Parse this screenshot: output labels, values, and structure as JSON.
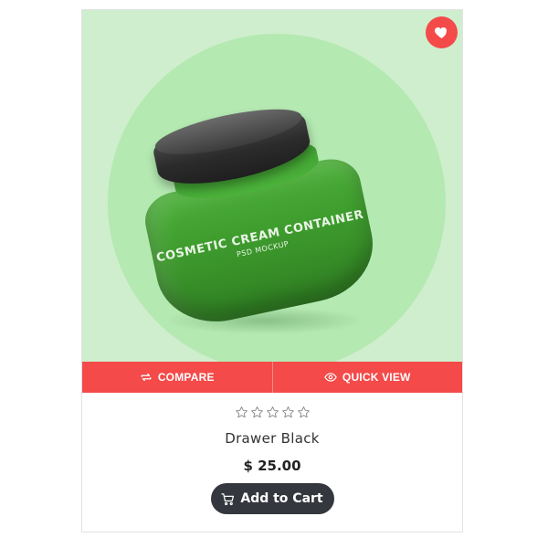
{
  "product": {
    "title": "Drawer Black",
    "price": "$ 25.00",
    "rating": 0,
    "rating_max": 5,
    "image_text": {
      "line1": "COSMETIC CREAM CONTAINER",
      "line2": "PSD MOCKUP"
    }
  },
  "actions": {
    "compare_label": "COMPARE",
    "quick_view_label": "QUICK VIEW",
    "add_to_cart_label": "Add to Cart"
  },
  "icons": {
    "favorite": "heart-icon",
    "compare": "compare-arrows-icon",
    "quick_view": "eye-icon",
    "cart": "cart-icon",
    "star": "star-outline-icon"
  },
  "colors": {
    "accent": "#f44a49",
    "image_bg": "#cfeecd",
    "image_circle": "#b4e9b1",
    "cart_button": "#34373d",
    "star_outline": "#888888"
  }
}
